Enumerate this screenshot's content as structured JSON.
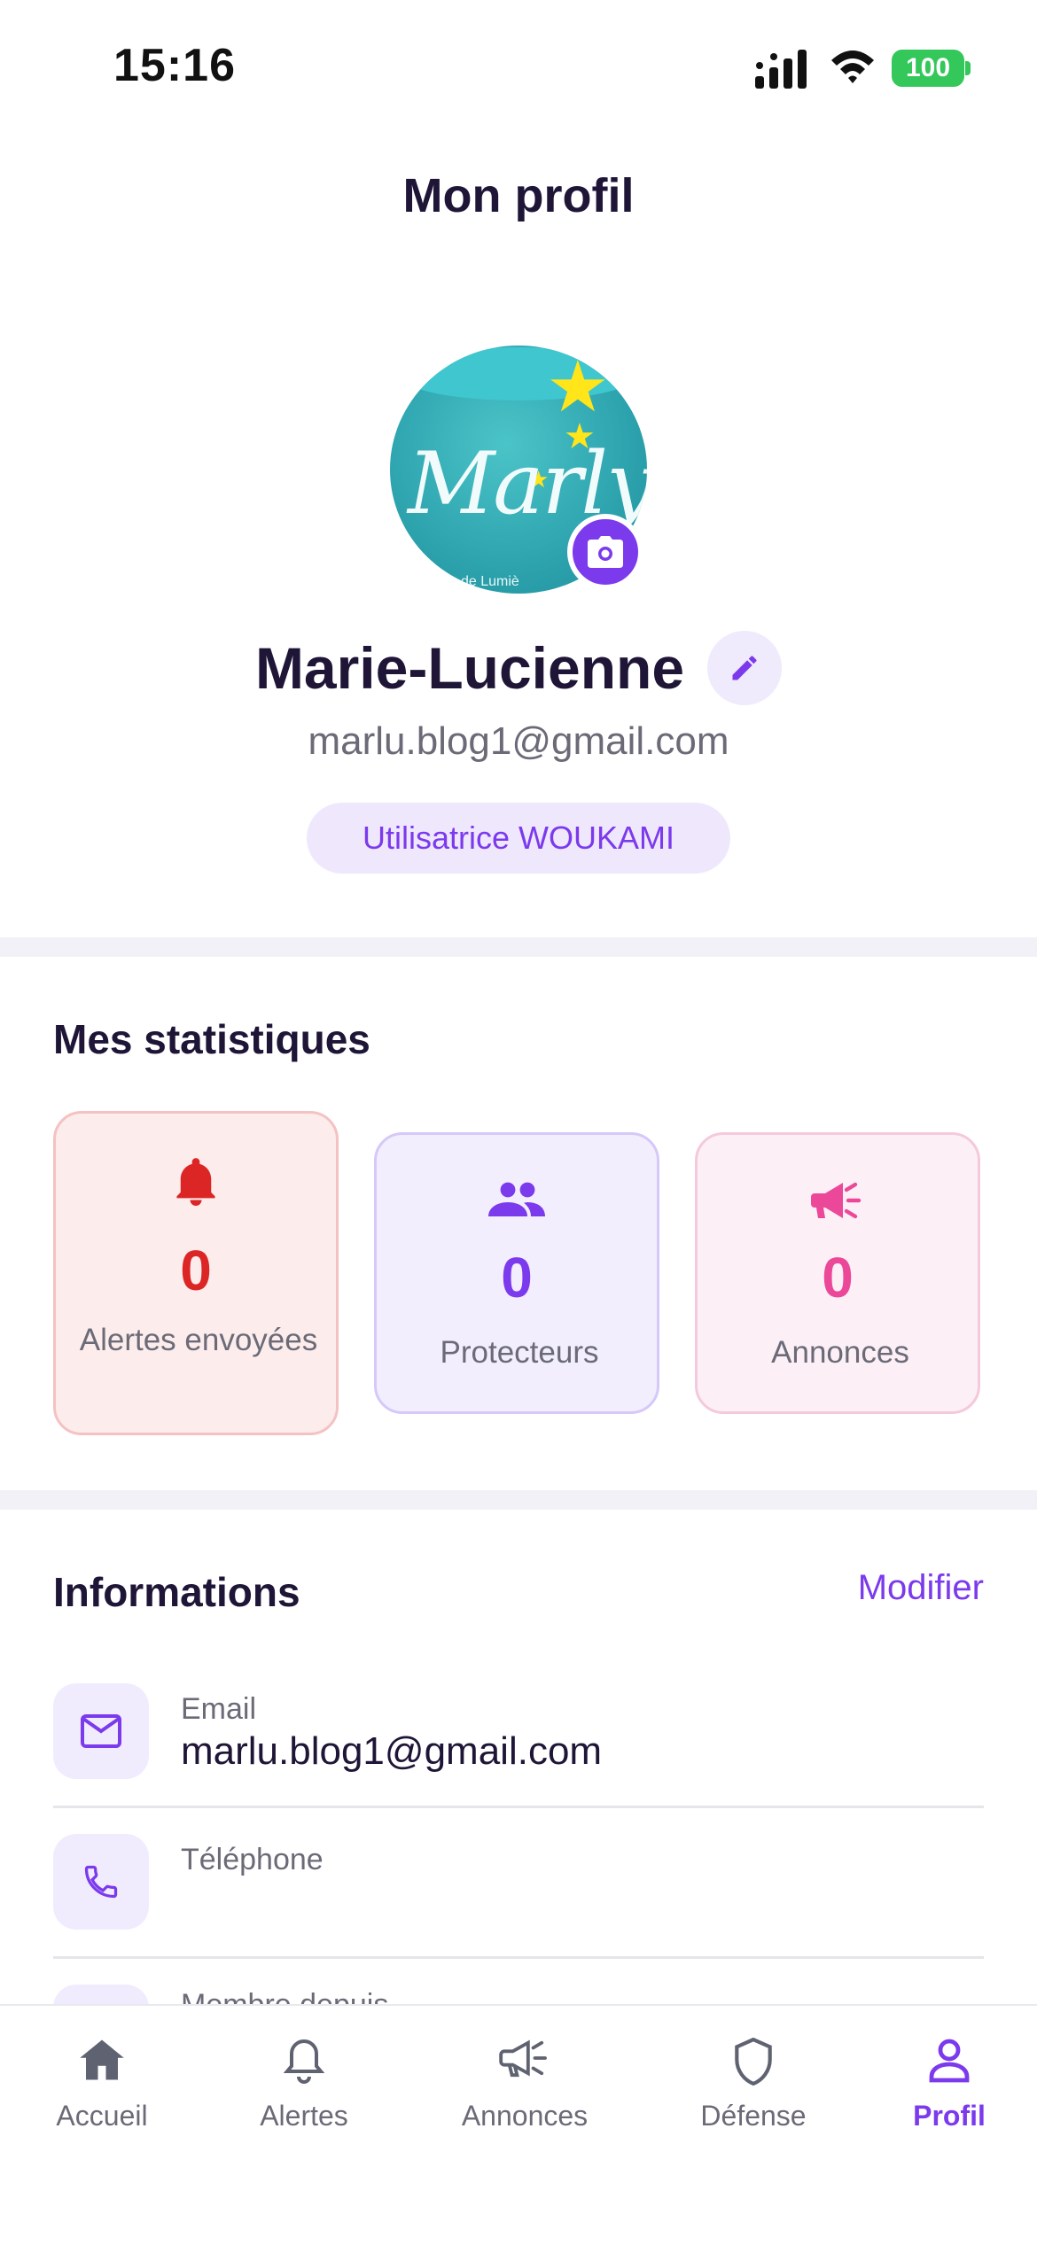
{
  "status_bar": {
    "time": "15:16",
    "battery": "100"
  },
  "header": {
    "title": "Mon profil"
  },
  "profile": {
    "avatar_text": "Marly",
    "avatar_subtext": "de Lumiè",
    "name": "Marie-Lucienne",
    "email": "marlu.blog1@gmail.com",
    "badge": "Utilisatrice WOUKAMI"
  },
  "stats": {
    "title": "Mes statistiques",
    "items": [
      {
        "value": "0",
        "label": "Alertes envoyées",
        "icon": "bell-icon",
        "color": "#dc2626"
      },
      {
        "value": "0",
        "label": "Protecteurs",
        "icon": "people-icon",
        "color": "#7c3aed"
      },
      {
        "value": "0",
        "label": "Annonces",
        "icon": "megaphone-icon",
        "color": "#ec4899"
      }
    ]
  },
  "info": {
    "title": "Informations",
    "modify_label": "Modifier",
    "rows": [
      {
        "label": "Email",
        "value": "marlu.blog1@gmail.com",
        "icon": "mail-icon"
      },
      {
        "label": "Téléphone",
        "value": "",
        "icon": "phone-icon"
      },
      {
        "label": "Membre depuis",
        "value": "",
        "icon": "calendar-icon"
      }
    ]
  },
  "tabs": [
    {
      "label": "Accueil",
      "icon": "home-icon",
      "active": false
    },
    {
      "label": "Alertes",
      "icon": "bell-icon",
      "active": false
    },
    {
      "label": "Annonces",
      "icon": "megaphone-icon",
      "active": false
    },
    {
      "label": "Défense",
      "icon": "shield-icon",
      "active": false
    },
    {
      "label": "Profil",
      "icon": "user-icon",
      "active": true
    }
  ],
  "colors": {
    "accent": "#7c3aed",
    "alert": "#dc2626",
    "pink": "#ec4899",
    "text": "#1f1537",
    "muted": "#6b6b78"
  }
}
